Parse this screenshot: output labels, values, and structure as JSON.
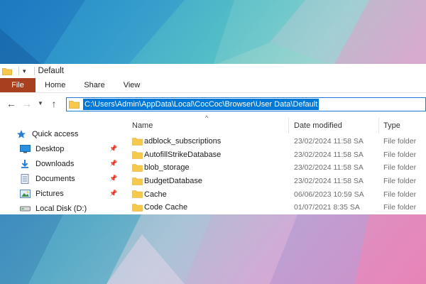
{
  "window": {
    "title": "Default"
  },
  "ribbon": {
    "tabs": [
      "File",
      "Home",
      "Share",
      "View"
    ]
  },
  "nav": {
    "back_icon": "arrow-left",
    "forward_icon": "arrow-right",
    "recent_icon": "chevron-down",
    "up_icon": "arrow-up"
  },
  "address": {
    "path": "C:\\Users\\Admin\\AppData\\Local\\CocCoc\\Browser\\User Data\\Default"
  },
  "columns": {
    "name": "Name",
    "date": "Date modified",
    "type": "Type"
  },
  "sidebar": {
    "items": [
      {
        "label": "Quick access",
        "icon": "star-icon",
        "pinned": false
      },
      {
        "label": "Desktop",
        "icon": "desktop-icon",
        "pinned": true
      },
      {
        "label": "Downloads",
        "icon": "download-icon",
        "pinned": true
      },
      {
        "label": "Documents",
        "icon": "documents-icon",
        "pinned": true
      },
      {
        "label": "Pictures",
        "icon": "pictures-icon",
        "pinned": true
      },
      {
        "label": "Local Disk (D:)",
        "icon": "drive-icon",
        "pinned": false
      }
    ]
  },
  "files": [
    {
      "name": "adblock_subscriptions",
      "date": "23/02/2024 11:58 SA",
      "type": "File folder"
    },
    {
      "name": "AutofillStrikeDatabase",
      "date": "23/02/2024 11:58 SA",
      "type": "File folder"
    },
    {
      "name": "blob_storage",
      "date": "23/02/2024 11:58 SA",
      "type": "File folder"
    },
    {
      "name": "BudgetDatabase",
      "date": "23/02/2024 11:58 SA",
      "type": "File folder"
    },
    {
      "name": "Cache",
      "date": "06/06/2023 10:59 SA",
      "type": "File folder"
    },
    {
      "name": "Code Cache",
      "date": "01/07/2021 8:35 SA",
      "type": "File folder"
    }
  ],
  "colors": {
    "file_tab": "#a8401f",
    "selection": "#0078d7",
    "folder": "#f6c94d"
  }
}
